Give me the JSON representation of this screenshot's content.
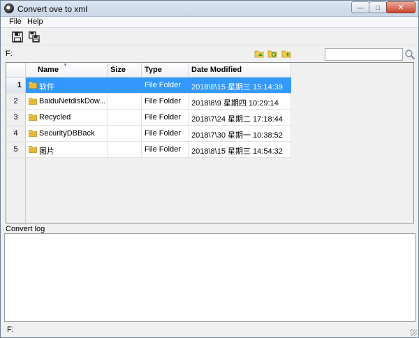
{
  "window": {
    "title": "Convert ove to xml"
  },
  "window_controls": {
    "minimize": "—",
    "maximize": "□",
    "close": "✕"
  },
  "menu": {
    "file": "File",
    "help": "Help"
  },
  "toolbar": {
    "icons": [
      "save-icon",
      "save-multiple-icon"
    ]
  },
  "path": {
    "label": "F:"
  },
  "path_buttons": {
    "icons": [
      "folder-up-icon",
      "folder-refresh-icon",
      "folder-new-icon"
    ]
  },
  "search": {
    "value": "",
    "placeholder": ""
  },
  "grid": {
    "columns": [
      "Name",
      "Size",
      "Type",
      "Date Modified"
    ],
    "rows": [
      {
        "num": "1",
        "name": "软件",
        "size": "",
        "type": "File Folder",
        "date": "2018\\8\\15 星期三 15:14:39",
        "selected": true
      },
      {
        "num": "2",
        "name": "BaiduNetdiskDow...",
        "size": "",
        "type": "File Folder",
        "date": "2018\\8\\9 星期四 10:29:14",
        "selected": false
      },
      {
        "num": "3",
        "name": "Recycled",
        "size": "",
        "type": "File Folder",
        "date": "2018\\7\\24 星期二 17:18:44",
        "selected": false
      },
      {
        "num": "4",
        "name": "SecurityDBBack",
        "size": "",
        "type": "File Folder",
        "date": "2018\\7\\30 星期一 10:38:52",
        "selected": false
      },
      {
        "num": "5",
        "name": "图片",
        "size": "",
        "type": "File Folder",
        "date": "2018\\8\\15 星期三 14:54:32",
        "selected": false
      }
    ]
  },
  "log": {
    "label": "Convert log",
    "content": ""
  },
  "status": {
    "text": "F:"
  },
  "colors": {
    "selection": "#3399ff",
    "folder": "#e8b93a"
  }
}
